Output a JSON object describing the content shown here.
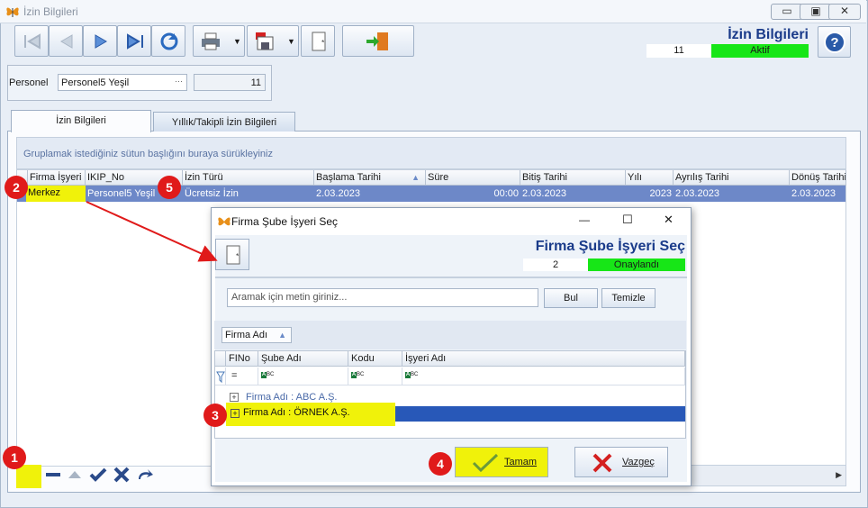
{
  "window": {
    "title": "İzin Bilgileri",
    "controls": {
      "minimize": "▭",
      "restore": "▣",
      "close": "✕"
    }
  },
  "header": {
    "title": "İzin Bilgileri",
    "record_count": "11",
    "status": "Aktif",
    "status_color": "#17e617"
  },
  "personel": {
    "label": "Personel",
    "value": "Personel5 Yeşil",
    "ellipsis": "···",
    "id": "11"
  },
  "tabs": [
    {
      "label": "İzin Bilgileri"
    },
    {
      "label": "Yıllık/Takipli İzin Bilgileri"
    }
  ],
  "grid": {
    "group_hint": "Gruplamak istediğiniz sütun başlığını buraya sürükleyiniz",
    "columns": [
      "Firma İşyeri",
      "IKIP_No",
      "İzin Türü",
      "Başlama Tarihi",
      "Süre",
      "Bitiş Tarihi",
      "Yılı",
      "Ayrılış Tarihi",
      "Dönüş Tarihi"
    ],
    "rows": [
      [
        "Merkez",
        "Personel5 Yeşil",
        "Ücretsiz İzin",
        "2.03.2023",
        "00:00",
        "2.03.2023",
        "2023",
        "2.03.2023",
        "2.03.2023"
      ]
    ]
  },
  "dialog": {
    "title": "Firma Şube İşyeri Seç",
    "header_title": "Firma Şube İşyeri Seç",
    "count": "2",
    "status": "Onaylandı",
    "search_placeholder": "Aramak için metin giriniz...",
    "search_button": "Bul",
    "clear_button": "Temizle",
    "group_chip": "Firma Adı",
    "columns": [
      "FINo",
      "Şube Adı",
      "Kodu",
      "İşyeri Adı"
    ],
    "filter_eq": "=",
    "abc": "ABC",
    "groups": [
      "Firma Adı : ABC A.Ş.",
      "Firma Adı : ÖRNEK A.Ş."
    ],
    "ok_label": "Tamam",
    "cancel_label": "Vazgeç",
    "controls": {
      "minimize": "—",
      "maximize": "☐",
      "close": "✕"
    }
  },
  "callouts": [
    "1",
    "2",
    "3",
    "4",
    "5"
  ],
  "colors": {
    "highlight": "#f0f20a",
    "callout": "#e01a1a",
    "selection": "#6d88c8",
    "selected_group": "#2858b8"
  }
}
